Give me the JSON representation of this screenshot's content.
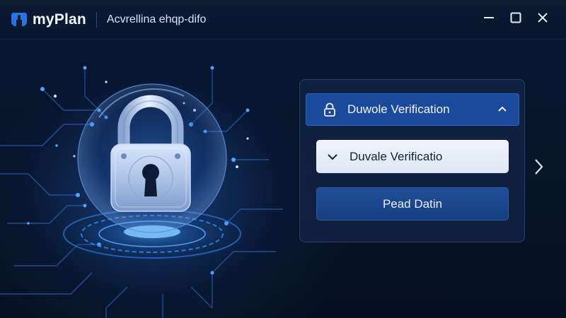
{
  "window": {
    "app_name": "myPlan",
    "subtitle": "Acvrellina ehqp-difo",
    "controls": [
      "minimize-icon",
      "maximize-icon",
      "close-icon"
    ]
  },
  "panel": {
    "accordion": {
      "label": "Duwole Verification",
      "icon": "lock-icon",
      "state_icon": "chevron-up-icon"
    },
    "dropdown": {
      "value": "Duvale Verificatio",
      "icon": "chevron-down-icon"
    },
    "primary_button": {
      "label": "Pead Datin"
    }
  },
  "navigation": {
    "next_icon": "chevron-right-icon"
  },
  "illustration": {
    "subject": "padlock-icon"
  },
  "colors": {
    "background": "#071326",
    "accent": "#1b4a9c",
    "glow": "#2d8cff"
  }
}
